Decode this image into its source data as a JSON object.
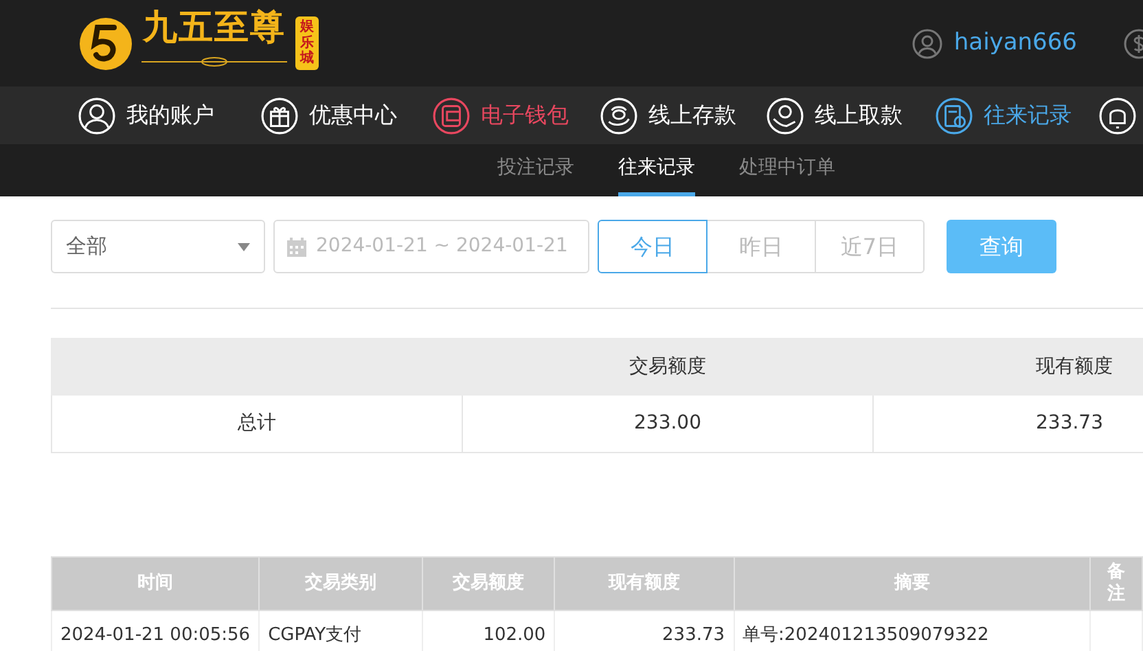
{
  "brand": {
    "name": "九五至尊",
    "badge": "娱乐城"
  },
  "user": {
    "name": "haiyan666"
  },
  "nav": [
    {
      "label": "我的账户",
      "color": "#ffffff"
    },
    {
      "label": "优惠中心",
      "color": "#ffffff"
    },
    {
      "label": "电子钱包",
      "color": "#e8475f"
    },
    {
      "label": "线上存款",
      "color": "#ffffff"
    },
    {
      "label": "线上取款",
      "color": "#ffffff"
    },
    {
      "label": "往来记录",
      "color": "#4aa8e8"
    }
  ],
  "subtabs": [
    {
      "label": "投注记录",
      "selected": false
    },
    {
      "label": "往来记录",
      "selected": true
    },
    {
      "label": "处理中订单",
      "selected": false
    }
  ],
  "filter": {
    "type": "全部",
    "date_range": "2024-01-21 ~ 2024-01-21",
    "ranges": [
      {
        "label": "今日",
        "selected": true
      },
      {
        "label": "昨日",
        "selected": false
      },
      {
        "label": "近7日",
        "selected": false
      }
    ],
    "search": "查询"
  },
  "summary": {
    "columns": [
      "",
      "交易额度",
      "现有额度"
    ],
    "rows": [
      [
        "总计",
        "233.00",
        "233.73"
      ]
    ]
  },
  "table": {
    "columns": [
      "时间",
      "交易类别",
      "交易额度",
      "现有额度",
      "摘要",
      "备注"
    ],
    "rows": [
      [
        "2024-01-21 00:05:56",
        "CGPAY支付",
        "102.00",
        "233.73",
        "单号:202401213509079322",
        ""
      ]
    ]
  }
}
